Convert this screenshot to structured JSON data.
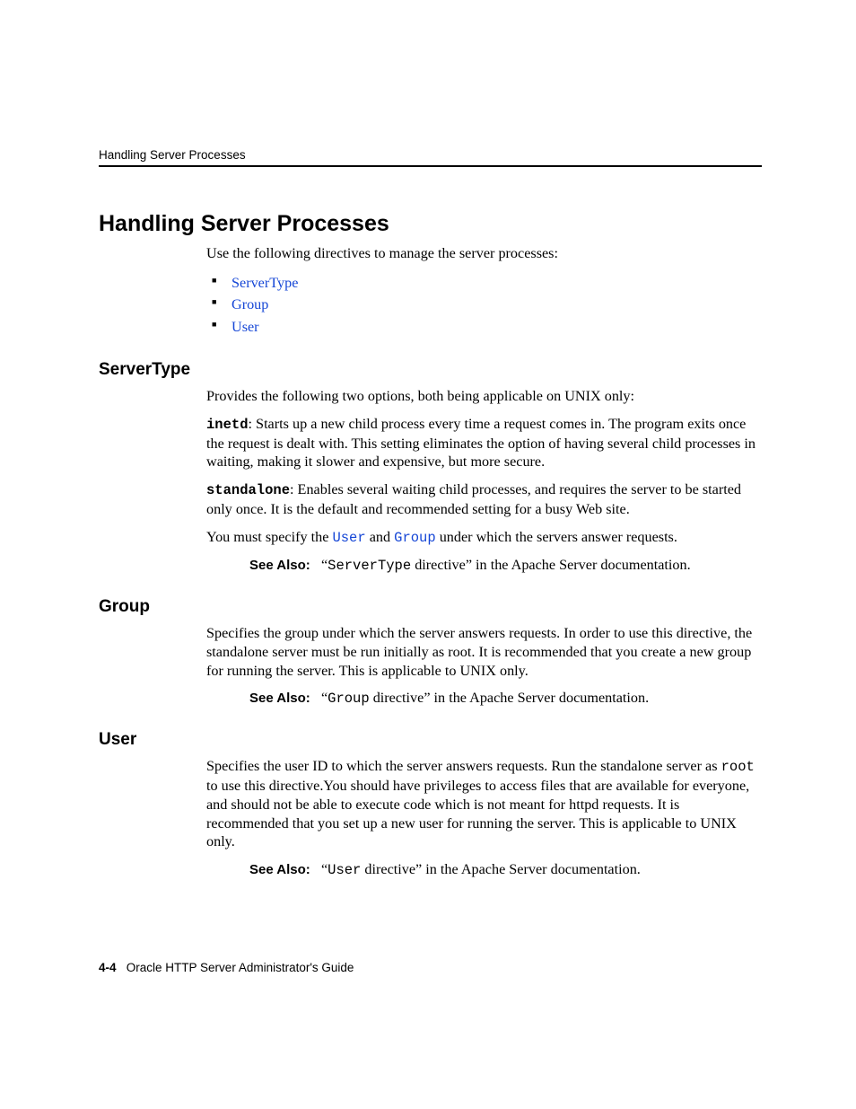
{
  "runningHead": "Handling Server Processes",
  "title": "Handling Server Processes",
  "intro": "Use the following directives to manage the server processes:",
  "bullets": {
    "serverType": "ServerType",
    "group": "Group",
    "user": "User"
  },
  "serverType": {
    "heading": "ServerType",
    "p1": "Provides the following two options, both being applicable on UNIX only:",
    "inetdLabel": "inetd",
    "inetdText": ": Starts up a new child process every time a request comes in. The program exits once the request is dealt with. This setting eliminates the option of having several child processes in waiting, making it slower and expensive, but more secure.",
    "standaloneLabel": "standalone",
    "standaloneText": ": Enables several waiting child processes, and requires the server to be started only once. It is the default and recommended setting for a busy Web site.",
    "mustSpecify_a": "You must specify the ",
    "mustSpecify_user": "User",
    "mustSpecify_b": " and ",
    "mustSpecify_group": "Group",
    "mustSpecify_c": " under which the servers answer requests.",
    "seeAlsoLabel": "See Also:",
    "seeAlso_a": "“",
    "seeAlso_code": "ServerType",
    "seeAlso_b": " directive” in the Apache Server documentation."
  },
  "group": {
    "heading": "Group",
    "p1": "Specifies the group under which the server answers requests. In order to use this directive, the standalone server must be run initially as root. It is recommended that you create a new group for running the server. This is applicable to UNIX only.",
    "seeAlsoLabel": "See Also:",
    "seeAlso_a": "“",
    "seeAlso_code": "Group",
    "seeAlso_b": " directive” in the Apache Server documentation."
  },
  "user": {
    "heading": "User",
    "p1_a": "Specifies the user ID to which the server answers requests. Run the standalone server as ",
    "p1_code": "root",
    "p1_b": " to use this directive.You should have privileges to access files that are available for everyone, and should not be able to execute code which is not meant for httpd requests. It is recommended that you set up a new user for running the server. This is applicable to UNIX only.",
    "seeAlsoLabel": "See Also:",
    "seeAlso_a": "“",
    "seeAlso_code": "User",
    "seeAlso_b": " directive” in the Apache Server documentation."
  },
  "footer": {
    "pageNum": "4-4",
    "bookTitle": "Oracle HTTP Server Administrator's Guide"
  }
}
